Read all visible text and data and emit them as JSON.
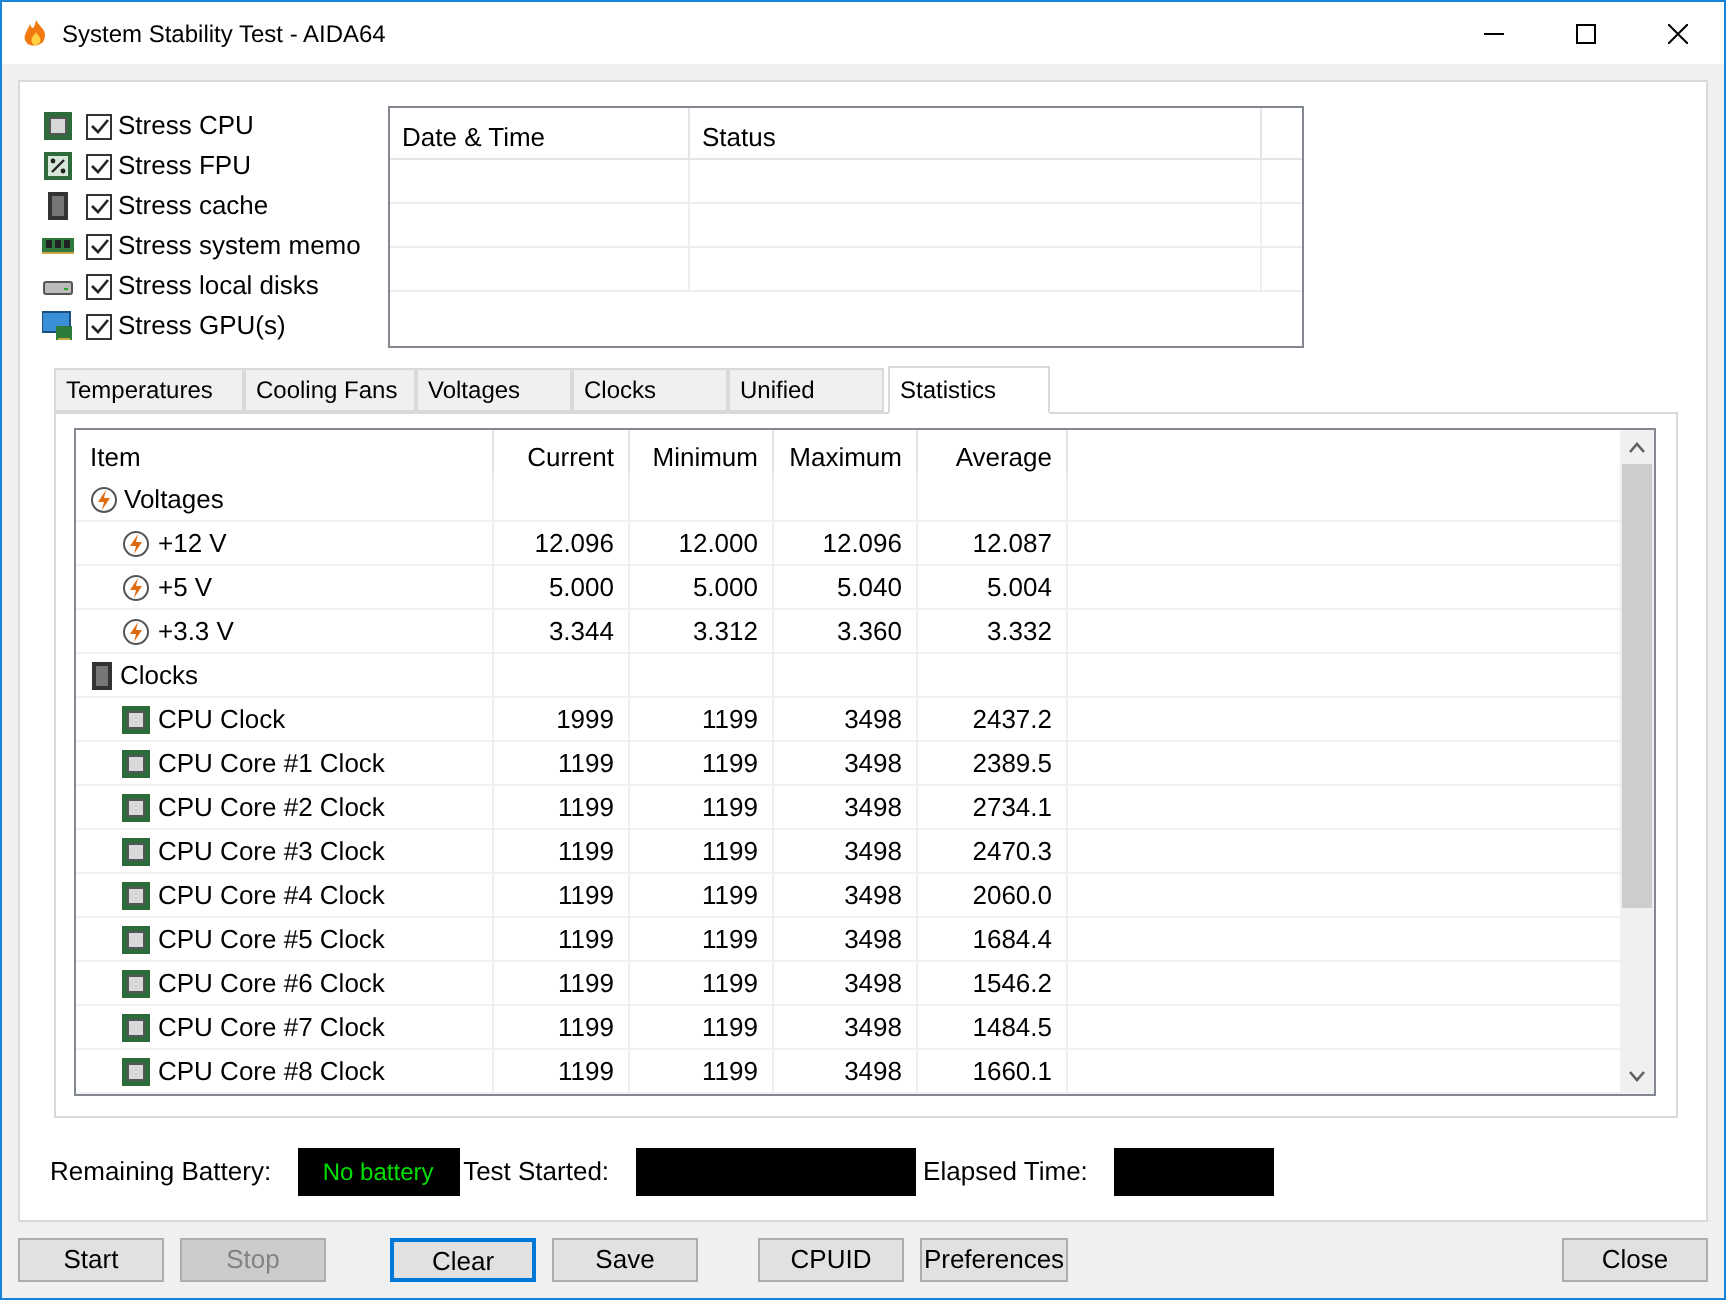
{
  "window": {
    "title": "System Stability Test - AIDA64"
  },
  "stress_options": [
    {
      "label": "Stress CPU",
      "checked": true,
      "kind": "cpu"
    },
    {
      "label": "Stress FPU",
      "checked": true,
      "kind": "fpu"
    },
    {
      "label": "Stress cache",
      "checked": true,
      "kind": "cache"
    },
    {
      "label": "Stress system memo",
      "checked": true,
      "kind": "memory"
    },
    {
      "label": "Stress local disks",
      "checked": true,
      "kind": "disk"
    },
    {
      "label": "Stress GPU(s)",
      "checked": true,
      "kind": "gpu"
    }
  ],
  "log": {
    "columns": [
      "Date & Time",
      "Status"
    ]
  },
  "tabs": [
    {
      "label": "Temperatures",
      "selected": false
    },
    {
      "label": "Cooling Fans",
      "selected": false
    },
    {
      "label": "Voltages",
      "selected": false
    },
    {
      "label": "Clocks",
      "selected": false
    },
    {
      "label": "Unified",
      "selected": false
    },
    {
      "label": "Statistics",
      "selected": true
    }
  ],
  "statistics": {
    "columns": [
      "Item",
      "Current",
      "Minimum",
      "Maximum",
      "Average"
    ],
    "groups": [
      {
        "label": "Voltages",
        "kind": "voltage",
        "children": [
          {
            "label": "+12 V",
            "values": [
              "12.096",
              "12.000",
              "12.096",
              "12.087"
            ]
          },
          {
            "label": "+5 V",
            "values": [
              "5.000",
              "5.000",
              "5.040",
              "5.004"
            ]
          },
          {
            "label": "+3.3 V",
            "values": [
              "3.344",
              "3.312",
              "3.360",
              "3.332"
            ]
          }
        ]
      },
      {
        "label": "Clocks",
        "kind": "clock",
        "children": [
          {
            "label": "CPU Clock",
            "values": [
              "1999",
              "1199",
              "3498",
              "2437.2"
            ]
          },
          {
            "label": "CPU Core #1 Clock",
            "values": [
              "1199",
              "1199",
              "3498",
              "2389.5"
            ]
          },
          {
            "label": "CPU Core #2 Clock",
            "values": [
              "1199",
              "1199",
              "3498",
              "2734.1"
            ]
          },
          {
            "label": "CPU Core #3 Clock",
            "values": [
              "1199",
              "1199",
              "3498",
              "2470.3"
            ]
          },
          {
            "label": "CPU Core #4 Clock",
            "values": [
              "1199",
              "1199",
              "3498",
              "2060.0"
            ]
          },
          {
            "label": "CPU Core #5 Clock",
            "values": [
              "1199",
              "1199",
              "3498",
              "1684.4"
            ]
          },
          {
            "label": "CPU Core #6 Clock",
            "values": [
              "1199",
              "1199",
              "3498",
              "1546.2"
            ]
          },
          {
            "label": "CPU Core #7 Clock",
            "values": [
              "1199",
              "1199",
              "3498",
              "1484.5"
            ]
          },
          {
            "label": "CPU Core #8 Clock",
            "values": [
              "1199",
              "1199",
              "3498",
              "1660.1"
            ]
          }
        ]
      }
    ]
  },
  "status": {
    "battery_label": "Remaining Battery:",
    "battery_value": "No battery",
    "test_started_label": "Test Started:",
    "elapsed_label": "Elapsed Time:"
  },
  "buttons": [
    {
      "label": "Start",
      "disabled": false,
      "focused": false
    },
    {
      "label": "Stop",
      "disabled": true,
      "focused": false
    },
    {
      "label": "Clear",
      "disabled": false,
      "focused": true
    },
    {
      "label": "Save",
      "disabled": false,
      "focused": false
    },
    {
      "label": "CPUID",
      "disabled": false,
      "focused": false
    },
    {
      "label": "Preferences",
      "disabled": false,
      "focused": false
    },
    {
      "label": "Close",
      "disabled": false,
      "focused": false
    }
  ]
}
